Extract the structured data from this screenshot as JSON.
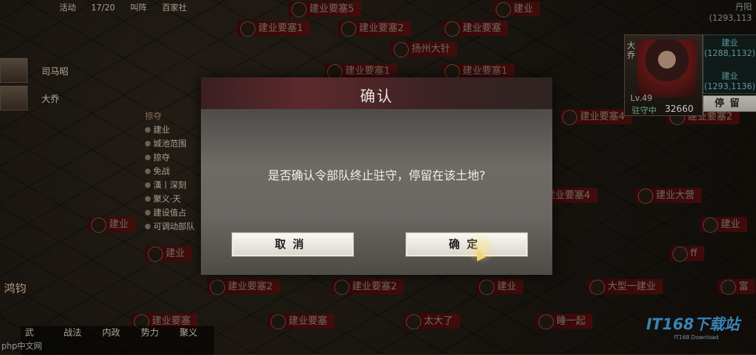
{
  "topbar": {
    "items": [
      "活动",
      "17/20",
      "叫阵",
      "百家社"
    ]
  },
  "coords_top": {
    "place": "丹阳",
    "coord": "(1293,113"
  },
  "map_labels": [
    "建业要塞5",
    "建业",
    "建业要塞1",
    "建业要塞2",
    "建业要塞",
    "扬州大针",
    "建业要塞1",
    "建业要塞1",
    "建业要塞4",
    "建业要塞2",
    "建业要塞4",
    "建业大营",
    "建业",
    "建业",
    "建业要塞2",
    "建业要塞2",
    "建业",
    "大型一建业",
    "富",
    "建业要塞",
    "建业要塞",
    "太大了",
    "睡一起",
    "ff",
    "建业"
  ],
  "commanders": [
    {
      "name": "司马昭"
    },
    {
      "name": "大乔"
    }
  ],
  "side_list": {
    "header": "掠夺",
    "items": [
      "建业",
      "城池范围",
      "掠夺",
      "免战",
      "漢丨深刻",
      "聚义·天",
      "建设值占",
      "可调动部队"
    ]
  },
  "hero_card": {
    "name": "大乔",
    "level": "Lv.49",
    "status": "驻守中",
    "troops": "32660"
  },
  "position_panel": {
    "from_city": "建业",
    "from_coord": "(1288,1132)",
    "to_city": "建业",
    "to_coord": "(1293,1136)"
  },
  "stay_button": "停留",
  "bottom_left_name": "鸿钧",
  "stats": [
    "武",
    "战法",
    "内政",
    "势力",
    "聚义"
  ],
  "watermarks": {
    "left": "php中文网",
    "right_logo": "IT168下载站",
    "right_sub": "IT168 Download"
  },
  "dialog": {
    "title": "确认",
    "message": "是否确认令部队终止驻守，停留在该土地?",
    "cancel_label": "取消",
    "ok_label": "确定"
  }
}
